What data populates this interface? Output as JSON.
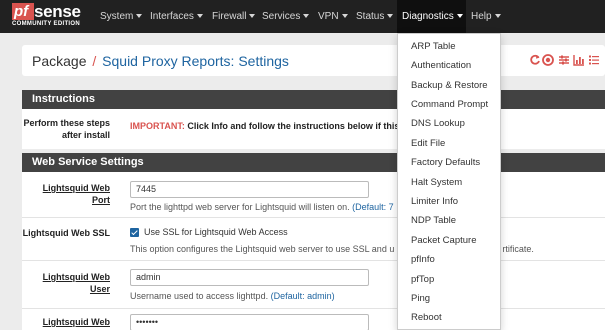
{
  "brand": {
    "logo_mark": "pf",
    "logo_text": "sense",
    "logo_sub": "COMMUNITY EDITION"
  },
  "nav": {
    "items": [
      {
        "label": "System"
      },
      {
        "label": "Interfaces"
      },
      {
        "label": "Firewall"
      },
      {
        "label": "Services"
      },
      {
        "label": "VPN"
      },
      {
        "label": "Status"
      },
      {
        "label": "Diagnostics"
      },
      {
        "label": "Help"
      }
    ],
    "active": "Diagnostics"
  },
  "breadcrumb": {
    "root": "Package",
    "separator": "/",
    "page": "Squid Proxy Reports: Settings"
  },
  "header_icons": [
    "reload-icon",
    "stop-icon",
    "sliders-icon",
    "bar-chart-icon",
    "list-icon",
    "help-icon"
  ],
  "instructions": {
    "title": "Instructions",
    "label": "Perform these steps after install",
    "important_prefix": "IMPORTANT:",
    "important_text": " Click Info and follow the instructions below if this is"
  },
  "web_service": {
    "title": "Web Service Settings",
    "port": {
      "label": "Lightsquid Web Port",
      "value": "7445",
      "help": "Port the lighttpd web server for Lightsquid will listen on.",
      "default": "(Default: 7"
    },
    "ssl": {
      "label": "Lightsquid Web SSL",
      "checkbox_label": "Use SSL for Lightsquid Web Access",
      "checked": true,
      "help": "This option configures the Lightsquid web server to use SSL and u",
      "help_tail": "rtificate."
    },
    "user": {
      "label": "Lightsquid Web User",
      "value": "admin",
      "help": "Username used to access lighttpd.",
      "default": "(Default: admin)"
    },
    "password": {
      "label": "Lightsquid Web",
      "value": "•••••••"
    }
  },
  "dropdown": {
    "items": [
      "ARP Table",
      "Authentication",
      "Backup & Restore",
      "Command Prompt",
      "DNS Lookup",
      "Edit File",
      "Factory Defaults",
      "Halt System",
      "Limiter Info",
      "NDP Table",
      "Packet Capture",
      "pfInfo",
      "pfTop",
      "Ping",
      "Reboot"
    ]
  },
  "colors": {
    "navbar": "#212121",
    "accent_red": "#d9534f",
    "link_blue": "#1e64a0",
    "panel_head": "#424242"
  }
}
